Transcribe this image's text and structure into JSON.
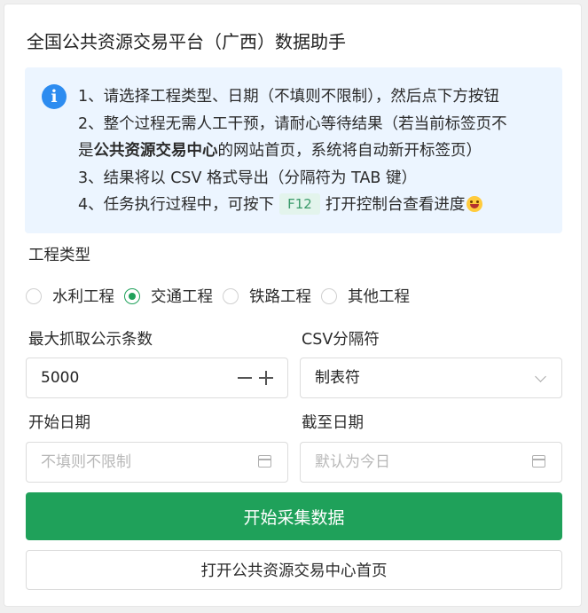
{
  "header": {
    "title": "全国公共资源交易平台（广西）数据助手"
  },
  "notice": {
    "icon": "info-icon",
    "line1": "1、请选择工程类型、日期（不填则不限制），然后点下方按钮",
    "line2": "2、整个过程无需人工干预，请耐心等待结果（若当前标签页不",
    "line3_prefix": "是",
    "line3_bold": "公共资源交易中心",
    "line3_suffix": "的网站首页，系统将自动新开标签页）",
    "line4": "3、结果将以 CSV 格式导出（分隔符为 TAB 键）",
    "line5_prefix": "4、任务执行过程中，可按下",
    "line5_key": "F12",
    "line5_suffix": "打开控制台查看进度",
    "emoji": "grinning-face-icon"
  },
  "project_type": {
    "label": "工程类型",
    "options": [
      {
        "label": "水利工程",
        "checked": false
      },
      {
        "label": "交通工程",
        "checked": true
      },
      {
        "label": "铁路工程",
        "checked": false
      },
      {
        "label": "其他工程",
        "checked": false
      }
    ]
  },
  "max_count": {
    "label": "最大抓取公示条数",
    "value": "5000"
  },
  "csv_separator": {
    "label": "CSV分隔符",
    "value": "制表符"
  },
  "start_date": {
    "label": "开始日期",
    "placeholder": "不填则不限制"
  },
  "end_date": {
    "label": "截至日期",
    "placeholder": "默认为今日"
  },
  "actions": {
    "start_label": "开始采集数据",
    "open_home_label": "打开公共资源交易中心首页"
  },
  "colors": {
    "primary": "#1fa15a",
    "info": "#2d8cf0",
    "notice_bg": "#ecf5ff"
  }
}
